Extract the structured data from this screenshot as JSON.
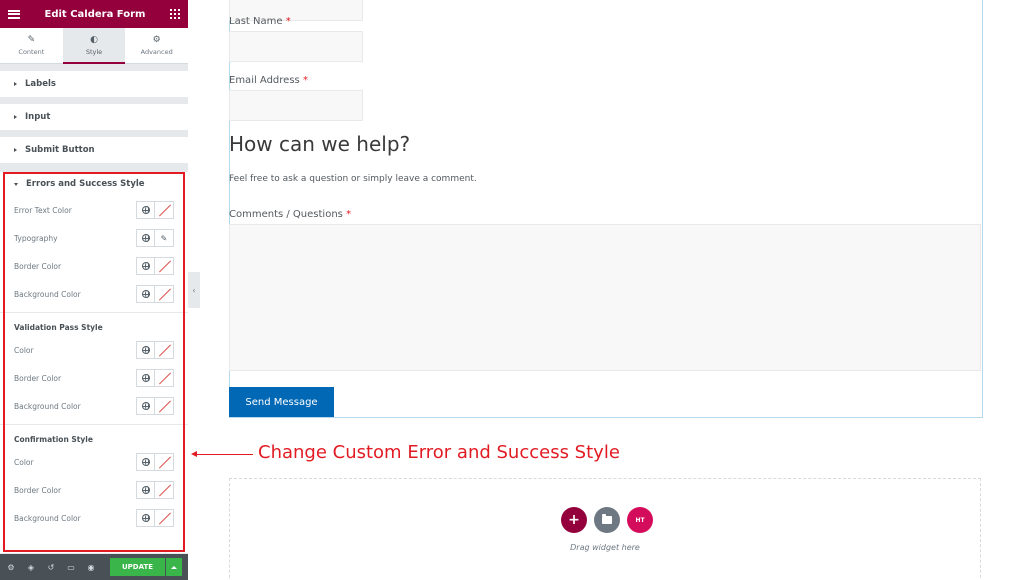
{
  "sidebar": {
    "header_title": "Edit Caldera Form",
    "tabs": [
      {
        "label": "Content"
      },
      {
        "label": "Style"
      },
      {
        "label": "Advanced"
      }
    ],
    "sections": [
      {
        "label": "Labels"
      },
      {
        "label": "Input"
      },
      {
        "label": "Submit Button"
      }
    ],
    "errors_section": {
      "title": "Errors and Success Style",
      "controls": [
        {
          "label": "Error Text Color"
        },
        {
          "label": "Typography"
        },
        {
          "label": "Border Color"
        },
        {
          "label": "Background Color"
        }
      ],
      "validation": {
        "title": "Validation Pass Style",
        "controls": [
          {
            "label": "Color"
          },
          {
            "label": "Border Color"
          },
          {
            "label": "Background Color"
          }
        ]
      },
      "confirmation": {
        "title": "Confirmation Style",
        "controls": [
          {
            "label": "Color"
          },
          {
            "label": "Border Color"
          },
          {
            "label": "Background Color"
          }
        ]
      }
    },
    "footer": {
      "update_label": "UPDATE"
    }
  },
  "form": {
    "last_name_label": "Last Name",
    "email_label": "Email Address",
    "required_mark": "*",
    "help_title": "How can we help?",
    "help_desc": "Feel free to ask a question or simply leave a comment.",
    "comments_label": "Comments / Questions",
    "send_label": "Send Message"
  },
  "annotation": {
    "text": "Change Custom Error and Success Style"
  },
  "drop_zone": {
    "text": "Drag widget here",
    "ht_label": "HT"
  },
  "colors": {
    "brand": "#93003c",
    "update": "#39b54a",
    "send": "#0068b4",
    "annotation": "#e21b23"
  }
}
